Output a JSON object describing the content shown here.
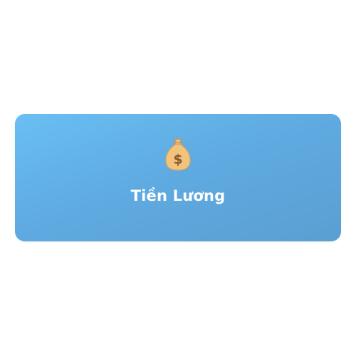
{
  "card": {
    "label": "Tiền Lương",
    "icon": "money-bag-icon",
    "colors": {
      "gradient_start": "#69bff3",
      "gradient_end": "#5a9fd2",
      "text": "#ffffff",
      "bag": "#f2c37d",
      "bag_outline": "#d9a35a",
      "dollar": "#8a5a2a"
    }
  }
}
